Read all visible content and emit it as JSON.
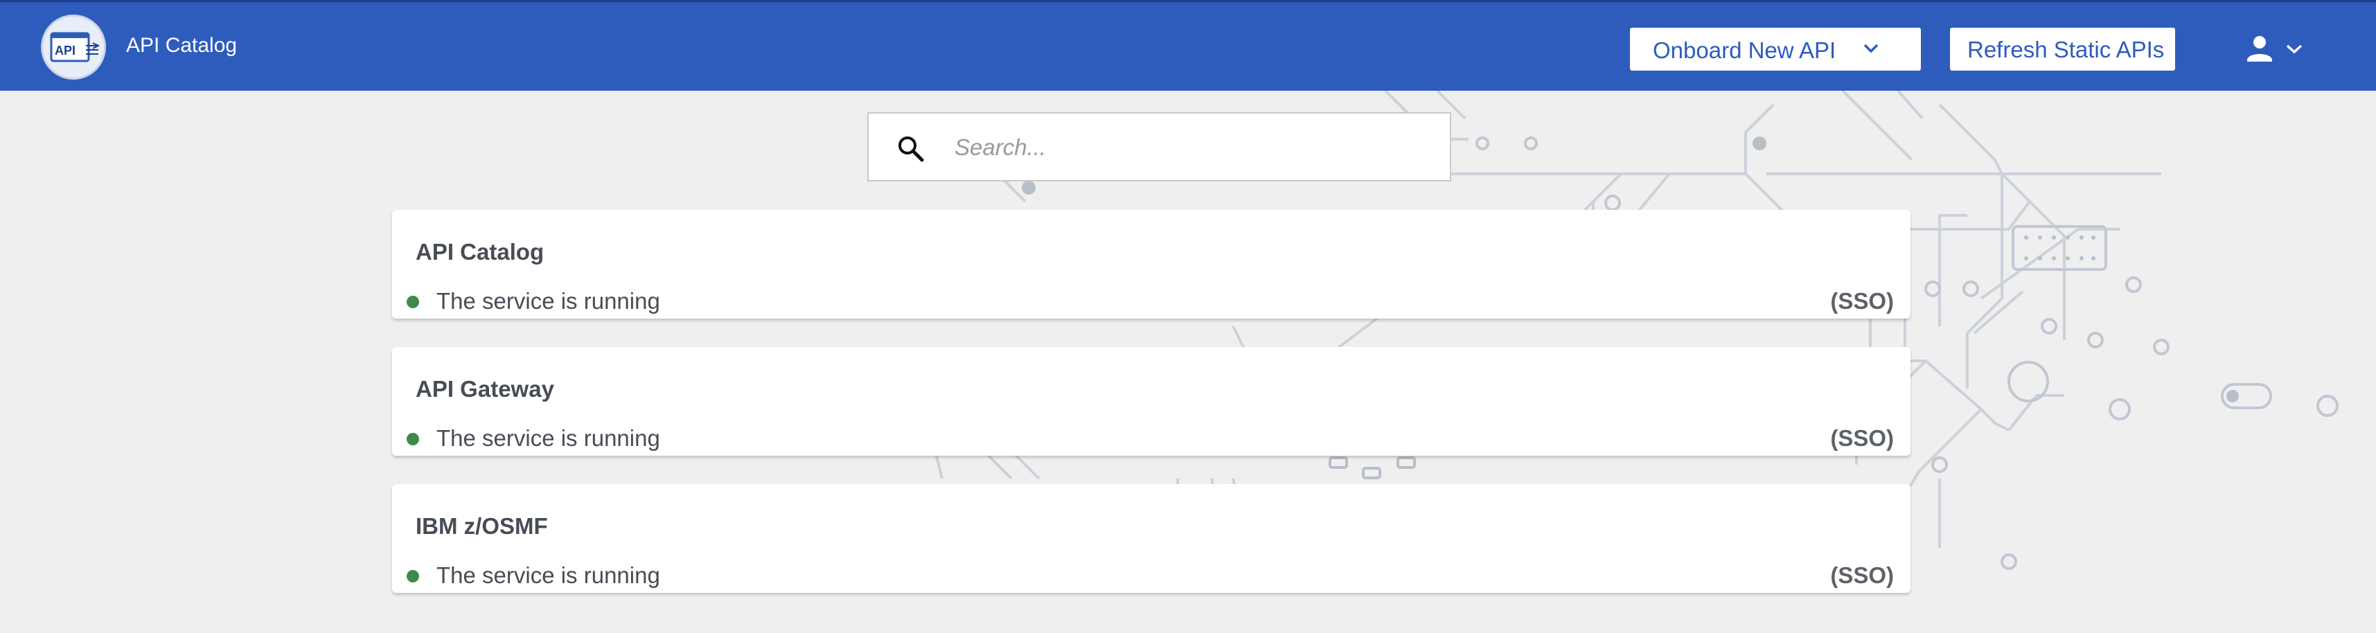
{
  "header": {
    "logo_text": "API",
    "title": "API Catalog",
    "onboard_button": "Onboard New API",
    "refresh_button": "Refresh Static APIs",
    "user_icon": "user-icon",
    "chevron_icon": "chevron-down-icon"
  },
  "search": {
    "placeholder": "Search...",
    "value": "",
    "icon": "search-icon"
  },
  "services": [
    {
      "title": "API Catalog",
      "status": "The service is running",
      "auth": "(SSO)"
    },
    {
      "title": "API Gateway",
      "status": "The service is running",
      "auth": "(SSO)"
    },
    {
      "title": "IBM z/OSMF",
      "status": "The service is running",
      "auth": "(SSO)"
    }
  ],
  "colors": {
    "header": "#2d5cbc",
    "background": "#efefef",
    "status_running": "#3e8a4a",
    "circuit": "#c9ced8"
  }
}
